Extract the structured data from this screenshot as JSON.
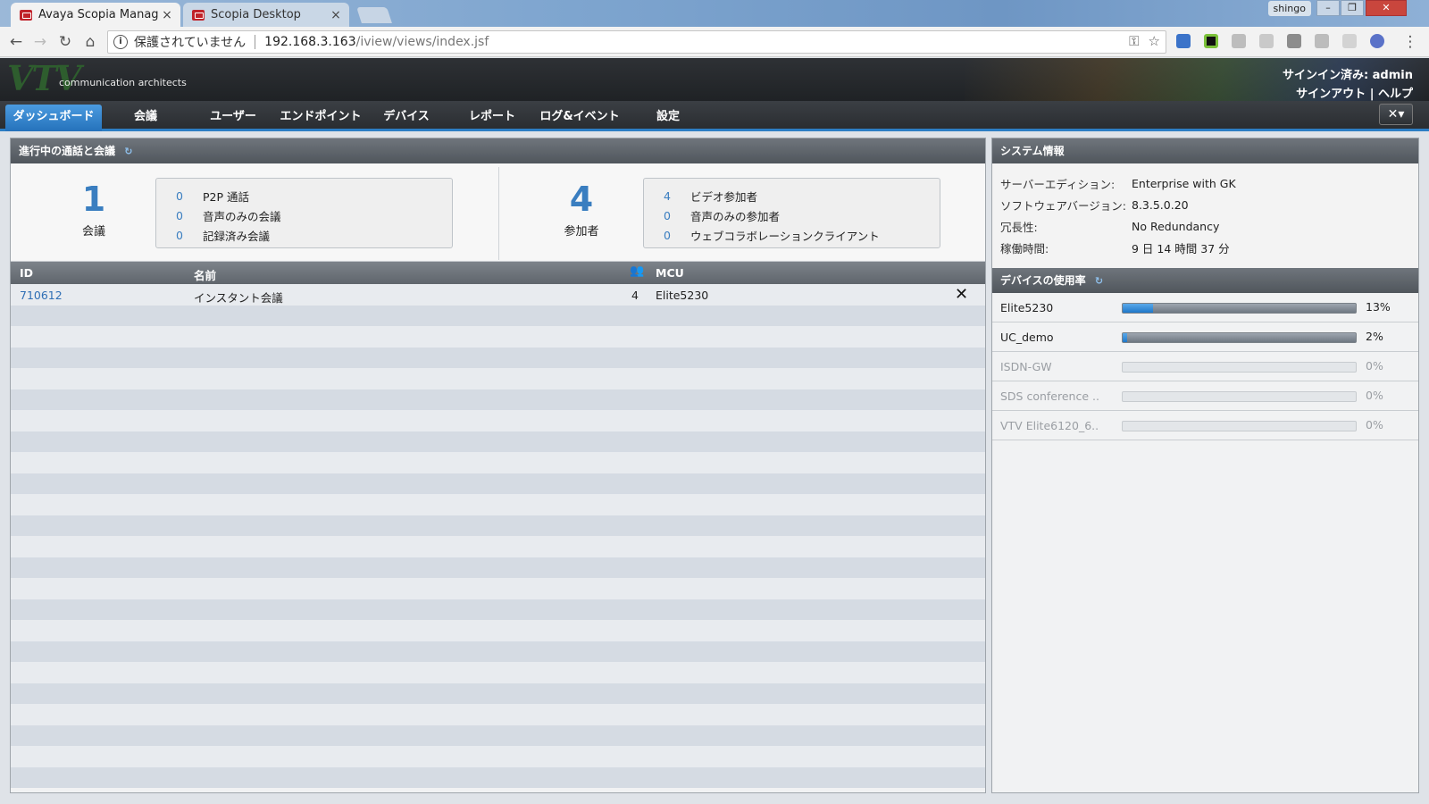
{
  "browser": {
    "tabs": [
      {
        "title": "Avaya Scopia Manager",
        "close": "×"
      },
      {
        "title": "Scopia Desktop",
        "close": "×"
      }
    ],
    "user": "shingo",
    "window_buttons": {
      "minimize": "–",
      "maximize": "❐",
      "close": "✕"
    },
    "address": {
      "security_label": "保護されていません",
      "host": "192.168.3.163",
      "path": "/iview/views/index.jsf"
    }
  },
  "header": {
    "logo": "VTV",
    "tagline": "communication architects",
    "signin": "サインイン済み: admin",
    "signout": "サインアウト",
    "separator": "|",
    "help": "ヘルプ"
  },
  "nav": {
    "items": [
      "ダッシュボード",
      "会議",
      "ユーザー",
      "エンドポイント",
      "デバイス",
      "レポート",
      "ログ&イベント",
      "設定"
    ],
    "active": "ダッシュボード"
  },
  "calls_panel": {
    "title": "進行中の通話と会議",
    "conferences": {
      "count": "1",
      "label": "会議",
      "stats": [
        {
          "n": "0",
          "label": "P2P 通話"
        },
        {
          "n": "0",
          "label": "音声のみの会議"
        },
        {
          "n": "0",
          "label": "記録済み会議"
        }
      ]
    },
    "participants": {
      "count": "4",
      "label": "参加者",
      "stats": [
        {
          "n": "4",
          "label": "ビデオ参加者"
        },
        {
          "n": "0",
          "label": "音声のみの参加者"
        },
        {
          "n": "0",
          "label": "ウェブコラボレーションクライアント"
        }
      ]
    },
    "table": {
      "columns": {
        "id": "ID",
        "name": "名前",
        "participants_icon": "participants-icon",
        "mcu": "MCU"
      },
      "rows": [
        {
          "id": "710612",
          "name": "インスタント会議",
          "participants": "4",
          "mcu": "Elite5230",
          "action": "✕"
        }
      ]
    }
  },
  "system_panel": {
    "title": "システム情報",
    "rows": [
      {
        "key": "サーバーエディション:",
        "value": "Enterprise with GK"
      },
      {
        "key": "ソフトウェアバージョン:",
        "value": "8.3.5.0.20"
      },
      {
        "key": "冗長性:",
        "value": "No Redundancy"
      },
      {
        "key": "稼働時間:",
        "value": "9 日 14 時間 37 分"
      }
    ]
  },
  "device_panel": {
    "title": "デバイスの使用率",
    "devices": [
      {
        "name": "Elite5230",
        "usage": 13,
        "label": "13%",
        "enabled": true
      },
      {
        "name": "UC_demo",
        "usage": 2,
        "label": "2%",
        "enabled": true
      },
      {
        "name": "ISDN-GW",
        "usage": 0,
        "label": "0%",
        "enabled": false
      },
      {
        "name": "SDS conference ..",
        "usage": 0,
        "label": "0%",
        "enabled": false
      },
      {
        "name": "VTV Elite6120_6..",
        "usage": 0,
        "label": "0%",
        "enabled": false
      }
    ]
  },
  "colors": {
    "accent": "#2d7ec4",
    "link": "#2f6fb5",
    "panel_header": "#5f656c"
  }
}
